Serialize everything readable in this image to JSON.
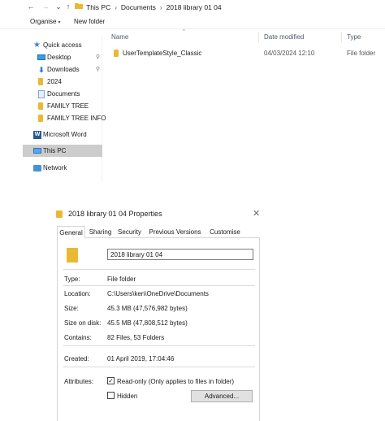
{
  "explorer": {
    "nav": {
      "back": "←",
      "forward": "→",
      "recent": "⌄",
      "up": "↑"
    },
    "breadcrumbs": [
      "This PC",
      "Documents",
      "2018 library 01 04"
    ],
    "breadcrumb_sep": "›",
    "toolbar": {
      "organise": "Organise",
      "organise_caret": "▾",
      "new_folder": "New folder"
    },
    "sidebar": {
      "items": [
        {
          "label": "Quick access",
          "icon": "star-icon"
        },
        {
          "label": "Desktop",
          "icon": "desktop-icon",
          "pinned": true
        },
        {
          "label": "Downloads",
          "icon": "download-icon",
          "pinned": true
        },
        {
          "label": "2024",
          "icon": "folder-icon"
        },
        {
          "label": "Documents",
          "icon": "documents-icon"
        },
        {
          "label": "FAMILY TREE",
          "icon": "folder-icon"
        },
        {
          "label": "FAMILY TREE INFO",
          "icon": "folder-icon"
        },
        {
          "label": "Microsoft Word",
          "icon": "word-icon"
        },
        {
          "label": "This PC",
          "icon": "pc-icon",
          "selected": true
        },
        {
          "label": "Network",
          "icon": "network-icon"
        }
      ],
      "pin_glyph": "📌"
    },
    "columns": {
      "name": "Name",
      "date_modified": "Date modified",
      "type": "Type"
    },
    "sort_caret": "^",
    "files": [
      {
        "name": "UserTemplateStyle_Classic",
        "date_modified": "04/03/2024 12:10",
        "type": "File folder"
      }
    ]
  },
  "properties": {
    "title": "2018 library 01 04 Properties",
    "close_glyph": "✕",
    "tabs": [
      "General",
      "Sharing",
      "Security",
      "Previous Versions",
      "Customise"
    ],
    "active_tab": "General",
    "folder_name": "2018 library 01 04",
    "fields": {
      "type_label": "Type:",
      "type_value": "File folder",
      "location_label": "Location:",
      "location_value": "C:\\Users\\ken\\OneDrive\\Documents",
      "size_label": "Size:",
      "size_value": "45.3 MB (47,576,982 bytes)",
      "size_on_disk_label": "Size on disk:",
      "size_on_disk_value": "45.5 MB (47,808,512 bytes)",
      "contains_label": "Contains:",
      "contains_value": "82 Files, 53 Folders",
      "created_label": "Created:",
      "created_value": "01 April 2019, 17:04:46",
      "attributes_label": "Attributes:"
    },
    "attributes": {
      "readonly_label": "Read-only (Only applies to files in folder)",
      "readonly_checked": true,
      "check_glyph": "✓",
      "hidden_label": "Hidden",
      "hidden_checked": false,
      "advanced_button": "Advanced..."
    },
    "colors": {
      "folder": "#e9b934",
      "selection": "#cccccc",
      "accent": "#3a84d4"
    }
  }
}
